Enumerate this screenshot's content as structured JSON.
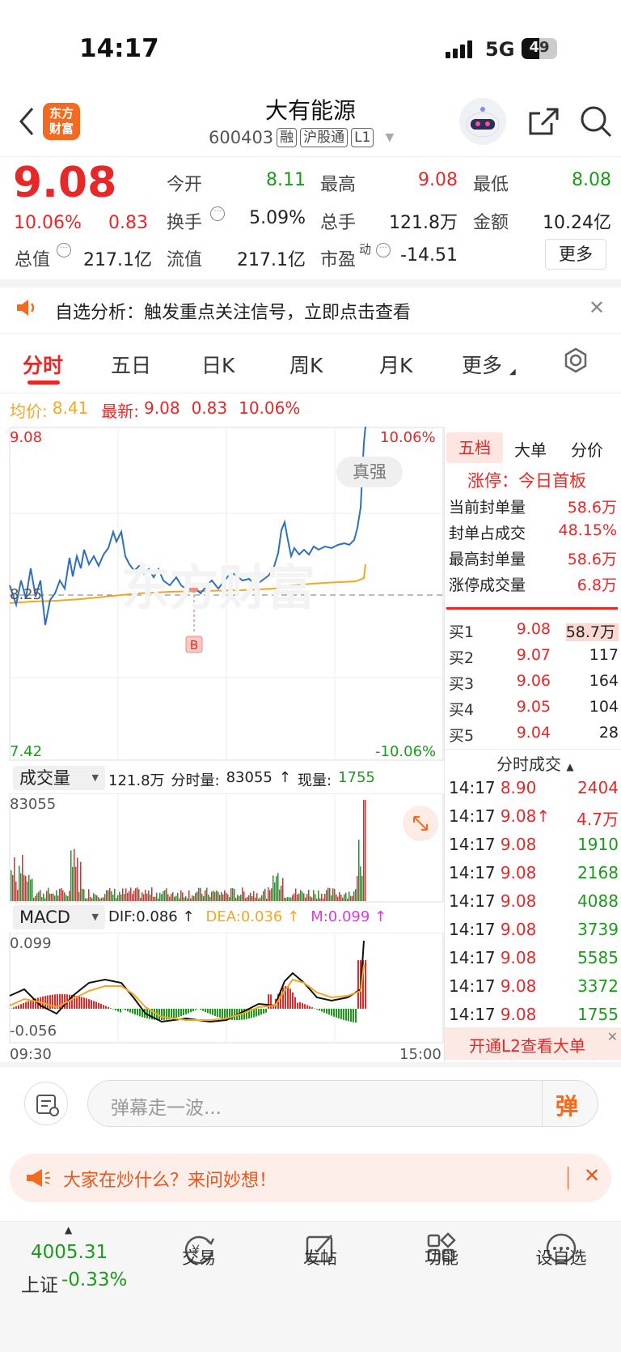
{
  "status": {
    "time": "14:17",
    "network": "5G",
    "battery": "49"
  },
  "header": {
    "logo_line1": "东方",
    "logo_line2": "财富",
    "title": "大有能源",
    "code": "600403",
    "tags": [
      "融",
      "沪股通",
      "L1"
    ]
  },
  "quote": {
    "price": "9.08",
    "pct": "10.06%",
    "change": "0.83",
    "rows": [
      [
        {
          "l": "今开",
          "v": "8.11",
          "c": "green"
        },
        {
          "l": "最高",
          "v": "9.08",
          "c": "red"
        },
        {
          "l": "最低",
          "v": "8.08",
          "c": "green"
        }
      ],
      [
        {
          "l": "换手",
          "v": "5.09%"
        },
        {
          "l": "总手",
          "v": "121.8万"
        },
        {
          "l": "金额",
          "v": "10.24亿"
        }
      ],
      [
        {
          "l": "总值",
          "v": "217.1亿"
        },
        {
          "l": "流值",
          "v": "217.1亿"
        },
        {
          "l": "市盈",
          "sup": "动",
          "v": "-14.51"
        }
      ]
    ],
    "more": "更多"
  },
  "notice": {
    "text": "自选分析：触发重点关注信号，立即点击查看"
  },
  "tabs": [
    "分时",
    "五日",
    "日K",
    "周K",
    "月K",
    "更多"
  ],
  "summary": {
    "avg_label": "均价:",
    "avg": "8.41",
    "latest_label": "最新:",
    "latest": "9.08",
    "change": "0.83",
    "pct": "10.06%"
  },
  "chart": {
    "ymax": "9.08",
    "ymin": "7.42",
    "pmax": "10.06%",
    "pmin": "-10.06%",
    "base": "8.25",
    "tag": "真强",
    "marker": "B",
    "time_start": "09:30",
    "time_end": "15:00"
  },
  "volume": {
    "selector": "成交量",
    "total": "121.8万",
    "fsl_label": "分时量:",
    "fsl": "83055",
    "now_label": "现量:",
    "now": "1755",
    "max": "83055"
  },
  "macd": {
    "selector": "MACD",
    "dif": "DIF:0.086",
    "dea": "DEA:0.036",
    "m": "M:0.099",
    "max": "0.099",
    "min": "-0.056"
  },
  "panel": {
    "tabs": [
      "五档",
      "大单",
      "分价"
    ],
    "limit_title": "涨停：今日首板",
    "stats": [
      {
        "l": "当前封单量",
        "v": "58.6万"
      },
      {
        "l": "封单占成交",
        "v": "48.15%"
      },
      {
        "l": "最高封单量",
        "v": "58.6万"
      },
      {
        "l": "涨停成交量",
        "v": "6.8万"
      }
    ],
    "bids": [
      {
        "l": "买1",
        "p": "9.08",
        "v": "58.7万"
      },
      {
        "l": "买2",
        "p": "9.07",
        "v": "117"
      },
      {
        "l": "买3",
        "p": "9.06",
        "v": "164"
      },
      {
        "l": "买4",
        "p": "9.05",
        "v": "104"
      },
      {
        "l": "买5",
        "p": "9.04",
        "v": "28"
      }
    ],
    "trades_title": "分时成交",
    "trades": [
      {
        "t": "14:17",
        "p": "8.90",
        "v": "2404",
        "c": "red"
      },
      {
        "t": "14:17",
        "p": "9.08",
        "arrow": "↑",
        "v": "4.7万",
        "c": "red"
      },
      {
        "t": "14:17",
        "p": "9.08",
        "v": "1910",
        "c": "green"
      },
      {
        "t": "14:17",
        "p": "9.08",
        "v": "2168",
        "c": "green"
      },
      {
        "t": "14:17",
        "p": "9.08",
        "v": "4088",
        "c": "green"
      },
      {
        "t": "14:17",
        "p": "9.08",
        "v": "3739",
        "c": "green"
      },
      {
        "t": "14:17",
        "p": "9.08",
        "v": "5585",
        "c": "green"
      },
      {
        "t": "14:17",
        "p": "9.08",
        "v": "3372",
        "c": "green"
      },
      {
        "t": "14:17",
        "p": "9.08",
        "v": "1755",
        "c": "green"
      }
    ],
    "l2": "开通L2查看大单"
  },
  "comment": {
    "placeholder": "弹幕走一波...",
    "btn": "弹"
  },
  "banner": {
    "text": "大家在炒什么？来问妙想！"
  },
  "bottom": {
    "index": "4005.31",
    "index_name": "上证",
    "index_pct": "-0.33%",
    "items": [
      "交易",
      "发帖",
      "功能",
      "设自选"
    ]
  }
}
